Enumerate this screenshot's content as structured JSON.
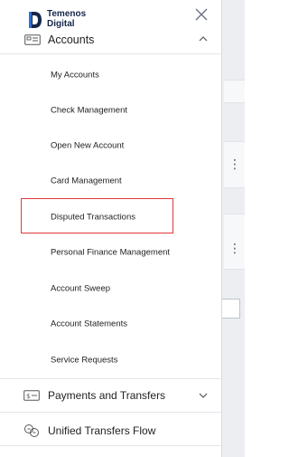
{
  "brand": {
    "line1": "Temenos",
    "line2": "Digital",
    "color": "#15264b"
  },
  "accounts": {
    "label": "Accounts",
    "items": [
      {
        "label": "My Accounts"
      },
      {
        "label": "Check Management"
      },
      {
        "label": "Open New Account"
      },
      {
        "label": "Card Management"
      },
      {
        "label": "Disputed Transactions"
      },
      {
        "label": "Personal Finance Management"
      },
      {
        "label": "Account Sweep"
      },
      {
        "label": "Account Statements"
      },
      {
        "label": "Service Requests"
      }
    ]
  },
  "nav": {
    "payments_label": "Payments and Transfers",
    "unified_label": "Unified Transfers Flow"
  },
  "highlight_color": "#e23b3b"
}
